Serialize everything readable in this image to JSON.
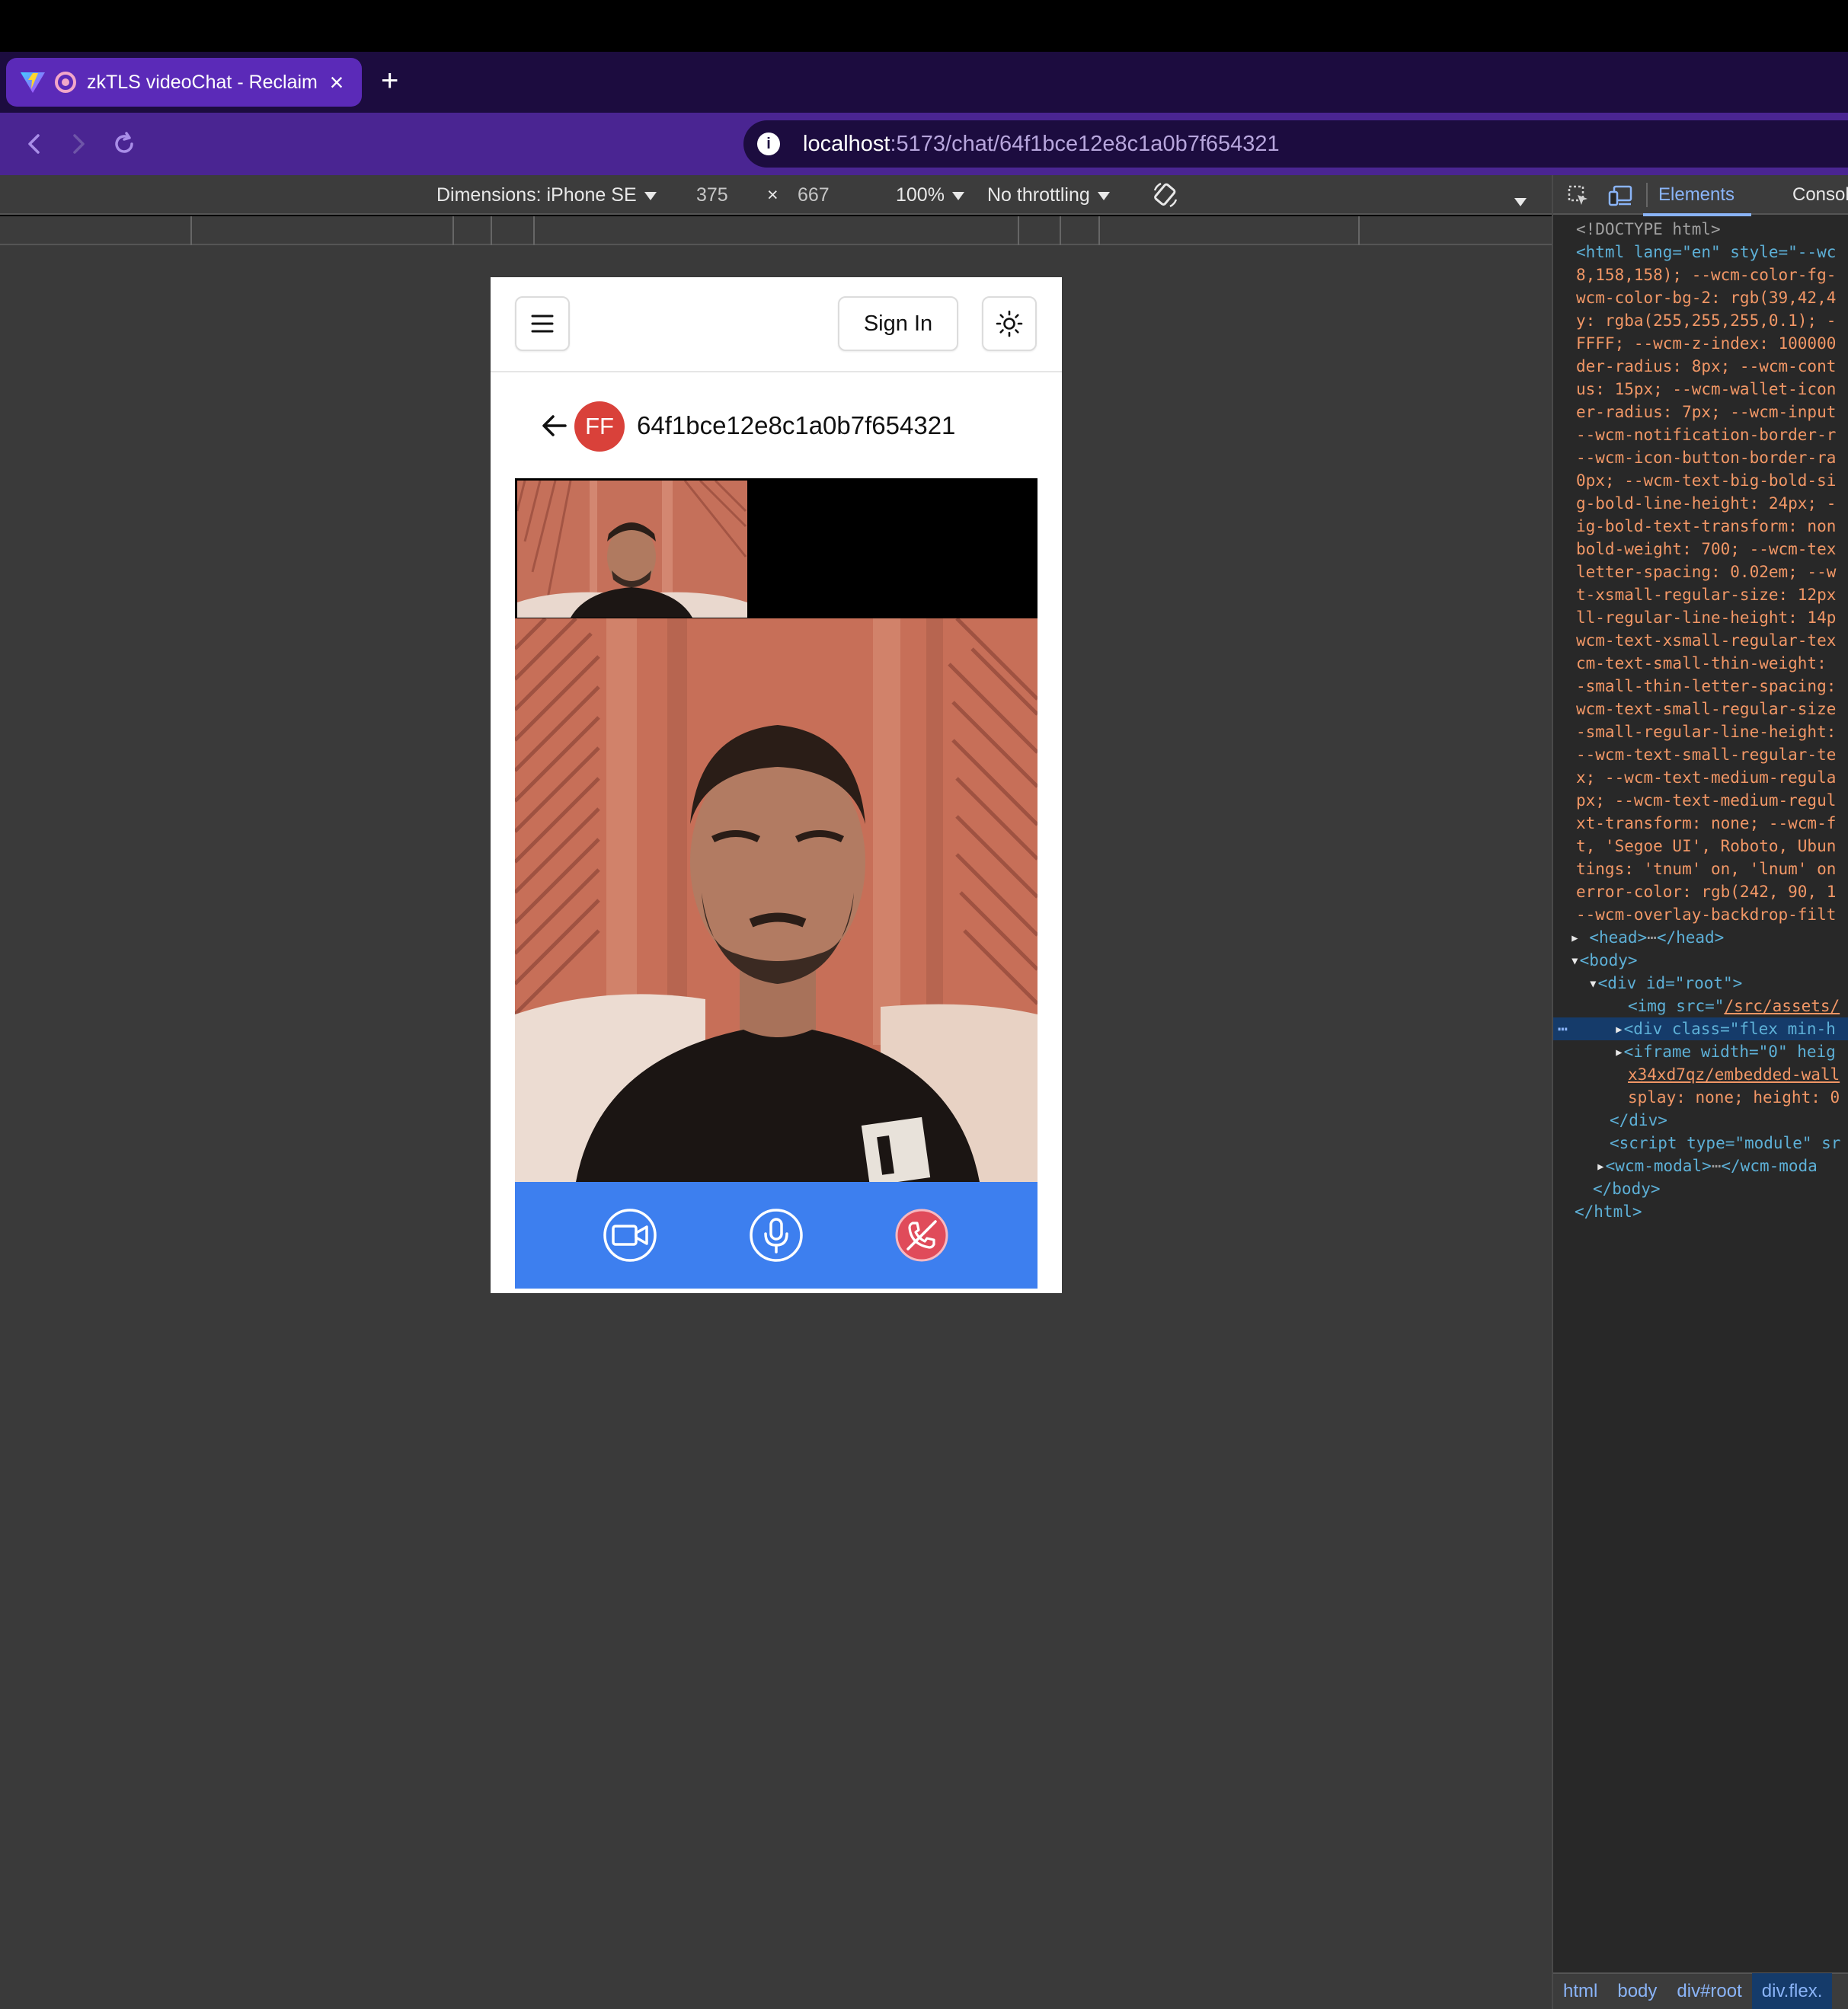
{
  "browser": {
    "tab": {
      "title": "zkTLS videoChat - Reclaim",
      "close": "×"
    },
    "new_tab": "+",
    "address": {
      "host": "localhost",
      "path": ":5173/chat/64f1bce12e8c1a0b7f654321"
    }
  },
  "device_toolbar": {
    "dimensions": "Dimensions: iPhone SE",
    "width": "375",
    "times": "×",
    "height": "667",
    "zoom": "100%",
    "throttling": "No throttling"
  },
  "app": {
    "header": {
      "sign_in": "Sign In"
    },
    "chat": {
      "avatar_initials": "FF",
      "chat_id": "64f1bce12e8c1a0b7f654321"
    },
    "controls": {
      "end_call_color": "#e04b5a",
      "bar_color": "#3d7fef"
    }
  },
  "devtools": {
    "tabs": {
      "elements": "Elements",
      "console": "Consol"
    },
    "dom_lines": [
      "<!DOCTYPE html>",
      "<html lang=\"en\" style=\"--wc",
      "8,158,158); --wcm-color-fg-",
      "wcm-color-bg-2: rgb(39,42,4",
      "y: rgba(255,255,255,0.1); -",
      "FFFF; --wcm-z-index: 100000",
      "der-radius: 8px; --wcm-cont",
      "us: 15px; --wcm-wallet-icon",
      "er-radius: 7px; --wcm-input",
      "--wcm-notification-border-r",
      "--wcm-icon-button-border-ra",
      "0px; --wcm-text-big-bold-si",
      "g-bold-line-height: 24px; -",
      "ig-bold-text-transform: non",
      "bold-weight: 700; --wcm-tex",
      "letter-spacing: 0.02em; --w",
      "t-xsmall-regular-size: 12px",
      "ll-regular-line-height: 14p",
      "wcm-text-xsmall-regular-tex",
      "cm-text-small-thin-weight: ",
      "-small-thin-letter-spacing:",
      "wcm-text-small-regular-size",
      "-small-regular-line-height:",
      "--wcm-text-small-regular-te",
      "x; --wcm-text-medium-regula",
      "px; --wcm-text-medium-regul",
      "xt-transform: none; --wcm-f",
      "t, 'Segoe UI', Roboto, Ubun",
      "tings: 'tnum' on, 'lnum' on",
      "error-color: rgb(242, 90, 1",
      "--wcm-overlay-backdrop-filt"
    ],
    "tree": {
      "head": "<head>",
      "head_close": "</head>",
      "body": "<body>",
      "root": "<div id=\"root\">",
      "img_prefix": "<img src=\"",
      "img_src": "/src/assets/",
      "div_flex": "<div class=\"flex min-h",
      "iframe": "<iframe width=\"0\" heig",
      "iframe_src": "x34xd7qz/embedded-wall",
      "iframe_style": "splay: none; height: 0",
      "div_close": "</div>",
      "script": "<script type=\"module\" sr",
      "wcm_modal": "<wcm-modal>",
      "wcm_modal_close": "</wcm-moda",
      "body_close": "</body>",
      "html_close": "</html>"
    },
    "breadcrumbs": [
      "html",
      "body",
      "div#root",
      "div.flex."
    ]
  }
}
